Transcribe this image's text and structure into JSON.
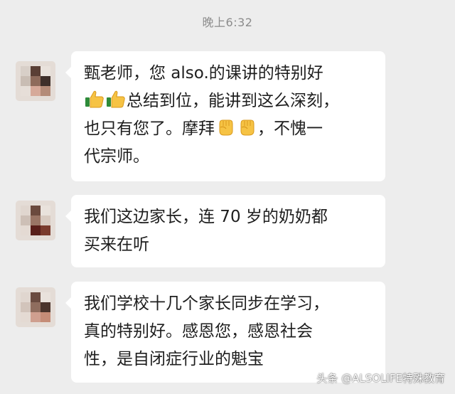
{
  "chat": {
    "timestamp": "晚上6:32",
    "messages": [
      {
        "lines": [
          "甄老师，您 also.的课讲的特别好",
          "总结到位，能讲到这么深刻，",
          "也只有您了。摩拜",
          "，不愧一",
          "代宗师。"
        ],
        "emojis": [
          "thumbs-up-icon",
          "thumbs-up-icon",
          "fist-icon",
          "fist-icon"
        ]
      },
      {
        "lines": [
          "我们这边家长，连 70 岁的奶奶都",
          "买来在听"
        ]
      },
      {
        "lines": [
          "我们学校十几个家长同步在学习，",
          "真的特别好。感恩您，感恩社会",
          "性，是自闭症行业的魁宝"
        ]
      }
    ]
  },
  "watermark": "头条 @ALSOLIFE特殊教育",
  "colors": {
    "background": "#ededed",
    "bubble": "#ffffff",
    "text": "#1e1e1e",
    "timestamp": "#8c8c8c"
  }
}
